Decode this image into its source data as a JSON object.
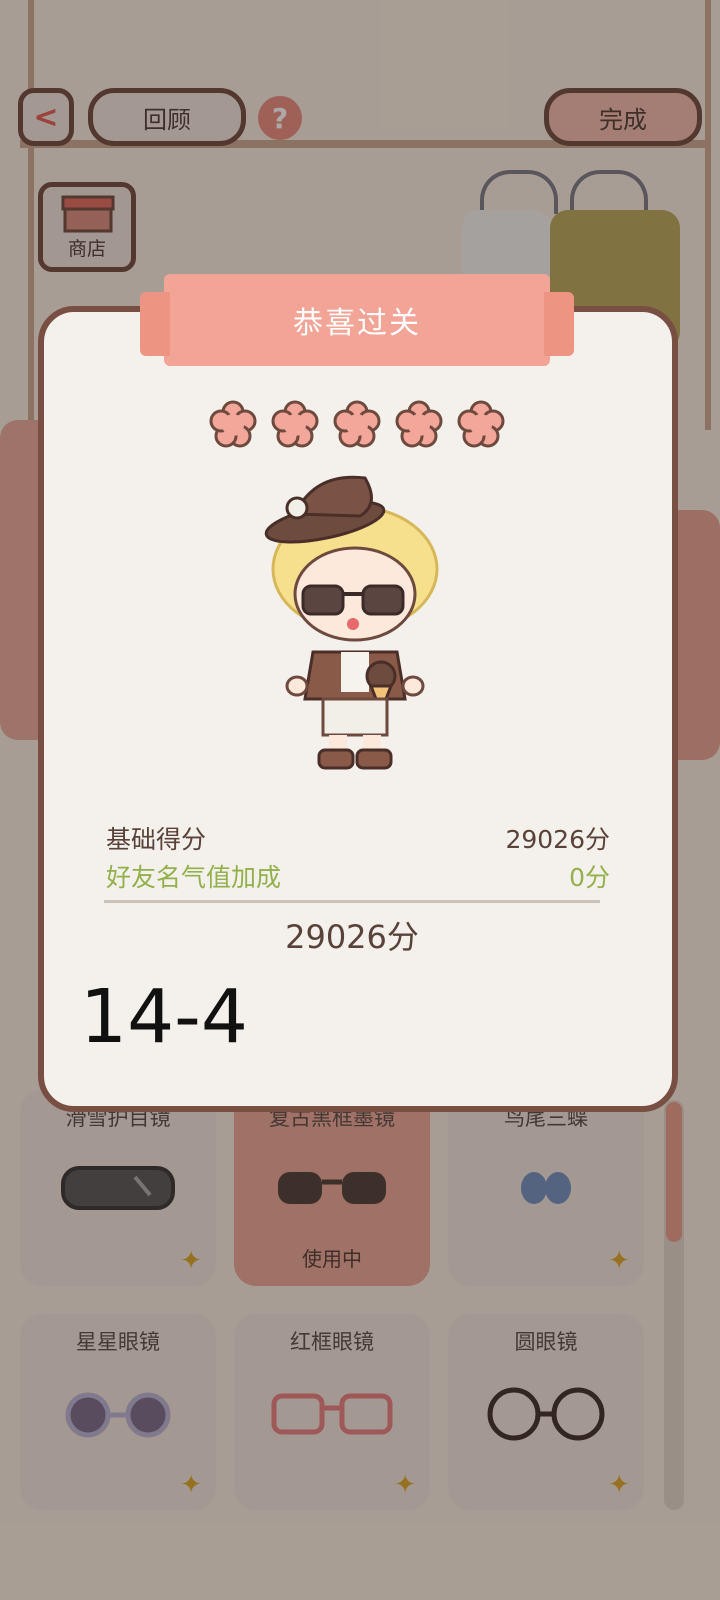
{
  "header": {
    "back_label": "<",
    "review_label": "回顾",
    "help_label": "?",
    "done_label": "完成",
    "shop_label": "商店"
  },
  "items": [
    {
      "name": "滑雪护目镜",
      "status": ""
    },
    {
      "name": "复古黑框墨镜",
      "status": "使用中"
    },
    {
      "name": "鸟尾三蝶",
      "status": ""
    },
    {
      "name": "星星眼镜",
      "status": ""
    },
    {
      "name": "红框眼镜",
      "status": ""
    },
    {
      "name": "圆眼镜",
      "status": ""
    }
  ],
  "modal": {
    "title": "恭喜过关",
    "stars_count": 5,
    "base_label": "基础得分",
    "base_value": "29026分",
    "bonus_label": "好友名气值加成",
    "bonus_value": "0分",
    "total_value": "29026分",
    "level": "14-4"
  },
  "colors": {
    "accent_pink": "#f2a596",
    "border_brown": "#7a4f43",
    "bonus_green": "#92b04c"
  }
}
